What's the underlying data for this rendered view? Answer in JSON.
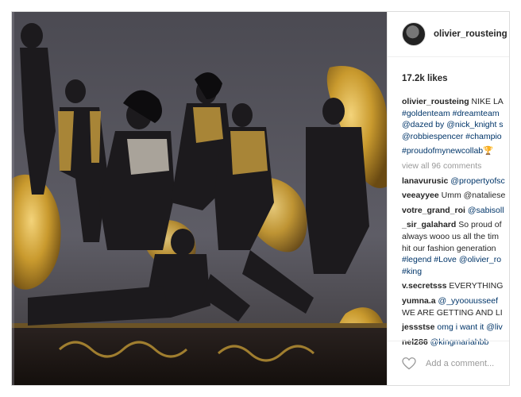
{
  "post": {
    "username": "olivier_rousteing",
    "likes": "17.2k likes",
    "caption": {
      "user": "olivier_rousteing",
      "lines": [
        "NIKE LA",
        "#goldenteam #dreamteam",
        "@dazed by @nick_knight s",
        "@robbiespencer #champio",
        "#proudofmynewcollab"
      ],
      "emoji": "🏆"
    },
    "view_all": "view all 96 comments",
    "comments": [
      {
        "user": "lanavurusic",
        "text": "@propertyofsc"
      },
      {
        "user": "veeayyee",
        "text": "Umm @nataliese"
      },
      {
        "user": "votre_grand_roi",
        "text": "@sabisoll"
      },
      {
        "user": "_sir_galahard",
        "text": "So proud of",
        "more": [
          "always wooo us all the tim",
          "hit our fashion generation",
          "#legend #Love @olivier_ro",
          "#king"
        ]
      },
      {
        "user": "v.secretsss",
        "text": "EVERYTHING"
      },
      {
        "user": "yumna.a",
        "text": "@_yyoouusseef",
        "more": [
          "WE ARE GETTING AND LI"
        ]
      },
      {
        "user": "jessstse",
        "text": "omg i want it @liv"
      },
      {
        "user": "nel286",
        "text": "@kingmariahbb"
      }
    ],
    "add_comment_placeholder": "Add a comment..."
  },
  "colors": {
    "hashtag": "#003569",
    "muted": "#999999",
    "text": "#262626",
    "gold": "#c9a23c"
  }
}
